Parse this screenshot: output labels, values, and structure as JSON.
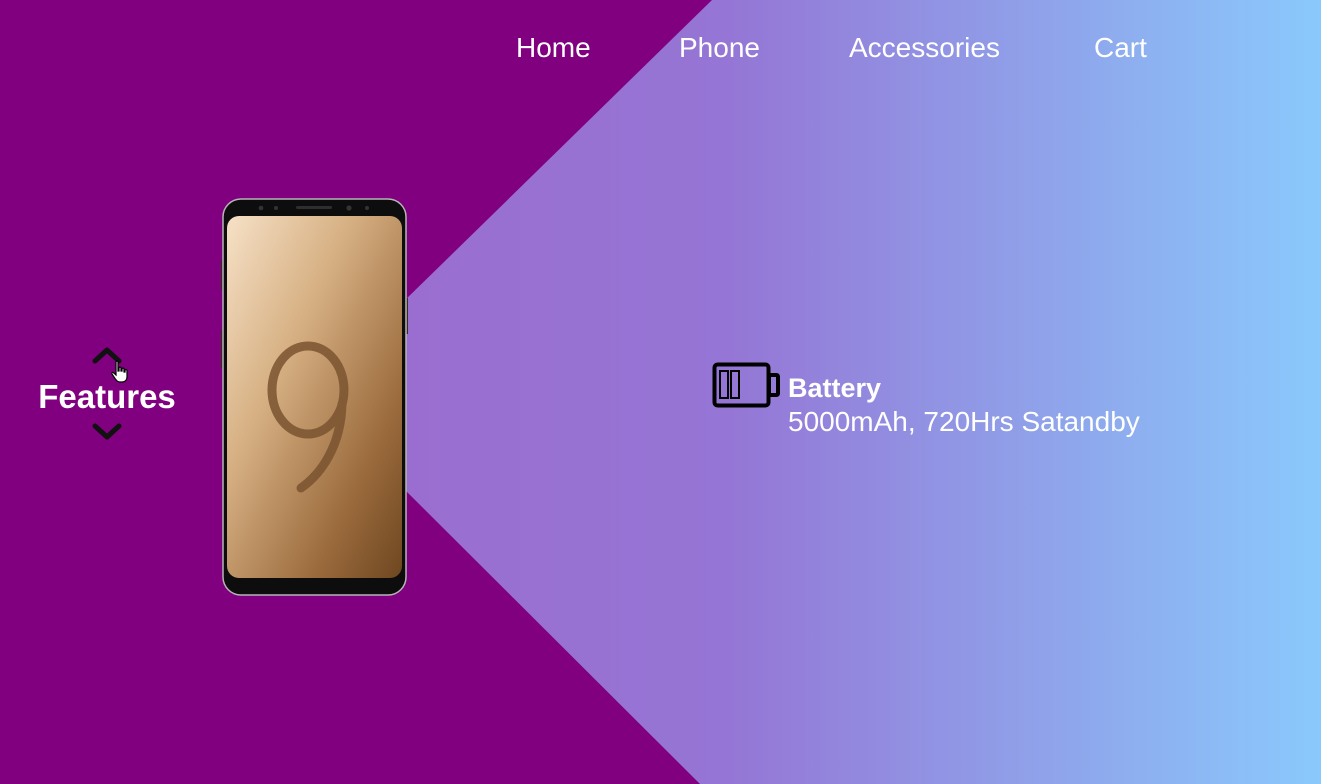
{
  "nav": {
    "home": "Home",
    "phone": "Phone",
    "accessories": "Accessories",
    "cart": "Cart"
  },
  "features": {
    "label": "Features",
    "up_icon": "chevron-up-icon",
    "down_icon": "chevron-down-icon"
  },
  "detail": {
    "icon": "battery-icon",
    "title": "Battery",
    "value": "5000mAh, 720Hrs Satandby"
  },
  "colors": {
    "purple_bg": "#800080",
    "gradient_start": "#9a6fd0",
    "gradient_end": "#8ac8fb",
    "text": "#ffffff",
    "phone_gold": "#c9a070"
  }
}
